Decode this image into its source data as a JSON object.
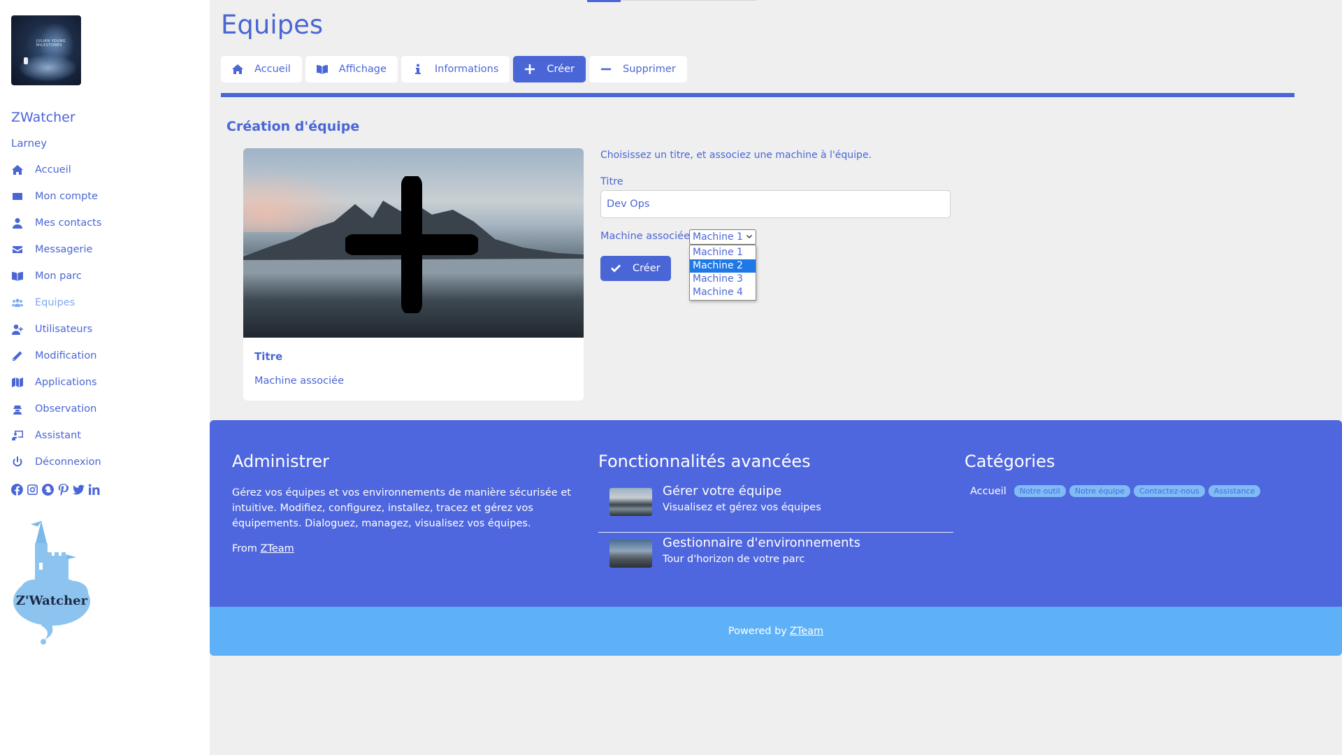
{
  "sidebar": {
    "app_name": "ZWatcher",
    "user_name": "Larney",
    "avatar_text": "JULIAN YOUNG\nMILESTONES",
    "logo_text": "Z'Watcher",
    "items": [
      {
        "label": "Accueil",
        "icon": "home-icon"
      },
      {
        "label": "Mon compte",
        "icon": "id-card-icon"
      },
      {
        "label": "Mes contacts",
        "icon": "user-icon"
      },
      {
        "label": "Messagerie",
        "icon": "envelope-icon"
      },
      {
        "label": "Mon parc",
        "icon": "book-open-icon"
      },
      {
        "label": "Equipes",
        "icon": "users-icon",
        "active": true
      },
      {
        "label": "Utilisateurs",
        "icon": "user-plus-icon"
      },
      {
        "label": "Modification",
        "icon": "pencil-icon"
      },
      {
        "label": "Applications",
        "icon": "map-icon"
      },
      {
        "label": "Observation",
        "icon": "user-secret-icon"
      },
      {
        "label": "Assistant",
        "icon": "chalkboard-icon"
      },
      {
        "label": "Déconnexion",
        "icon": "power-icon"
      }
    ],
    "social": [
      "facebook-icon",
      "instagram-icon",
      "snapchat-icon",
      "pinterest-icon",
      "twitter-icon",
      "linkedin-icon"
    ]
  },
  "header": {
    "title": "Equipes",
    "tabs": [
      {
        "label": "Accueil",
        "icon": "home-icon"
      },
      {
        "label": "Affichage",
        "icon": "book-open-icon"
      },
      {
        "label": "Informations",
        "icon": "info-icon"
      },
      {
        "label": "Créer",
        "icon": "plus-icon",
        "active": true
      },
      {
        "label": "Supprimer",
        "icon": "minus-icon"
      }
    ]
  },
  "main": {
    "section_title": "Création d'équipe",
    "card": {
      "title": "Titre",
      "machine": "Machine associée"
    },
    "form": {
      "intro": "Choisissez un titre, et associez une machine à l'équipe.",
      "title_label": "Titre",
      "title_value": "Dev Ops",
      "machine_label": "Machine associée",
      "machine_selected": "Machine 1",
      "machine_options": [
        "Machine 1",
        "Machine 2",
        "Machine 3",
        "Machine 4"
      ],
      "machine_highlighted": "Machine 2",
      "submit_label": "Créer"
    }
  },
  "footer": {
    "admin": {
      "title": "Administrer",
      "text": "Gérez vos équipes et vos environnements de manière sécurisée et intuitive. Modifiez, configurez, installez, tracez et gérez vos équipements. Dialoguez, managez, visualisez vos équipes.",
      "from_label": "From",
      "from_link": "ZTeam"
    },
    "advanced": {
      "title": "Fonctionnalités avancées",
      "items": [
        {
          "title": "Gérer votre équipe",
          "subtitle": "Visualisez et gérez vos équipes"
        },
        {
          "title": "Gestionnaire d'environnements",
          "subtitle": "Tour d'horizon de votre parc"
        }
      ]
    },
    "categories": {
      "title": "Catégories",
      "home": "Accueil",
      "tags": [
        "Notre outil",
        "Notre équipe",
        "Contactez-nous",
        "Assistance"
      ]
    },
    "powered_label": "Powered by",
    "powered_link": "ZTeam"
  },
  "colors": {
    "accent": "#4a66d6",
    "footer": "#4f67de",
    "subfooter": "#5fb1f7",
    "active_nav": "#7da8f5",
    "option_highlight": "#1e78e6"
  }
}
